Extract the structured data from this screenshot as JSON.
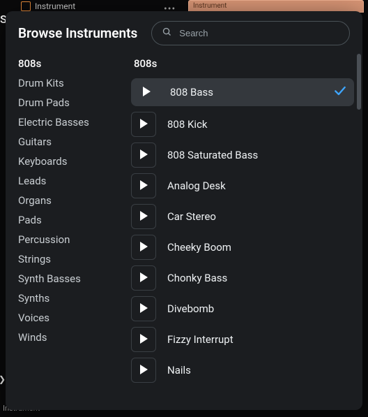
{
  "bg": {
    "instrument_tab": "Instrument",
    "mini_label": "Instrument",
    "edge_s": "S",
    "bottom": "Instrument"
  },
  "modal": {
    "title": "Browse Instruments",
    "search_placeholder": "Search"
  },
  "categories": [
    "808s",
    "Drum Kits",
    "Drum Pads",
    "Electric Basses",
    "Guitars",
    "Keyboards",
    "Leads",
    "Organs",
    "Pads",
    "Percussion",
    "Strings",
    "Synth Basses",
    "Synths",
    "Voices",
    "Winds"
  ],
  "selected_category_index": 0,
  "list_heading": "808s",
  "instruments": [
    "808 Bass",
    "808 Kick",
    "808 Saturated Bass",
    "Analog Desk",
    "Car Stereo",
    "Cheeky Boom",
    "Chonky Bass",
    "Divebomb",
    "Fizzy Interrupt",
    "Nails"
  ],
  "selected_instrument_index": 0
}
